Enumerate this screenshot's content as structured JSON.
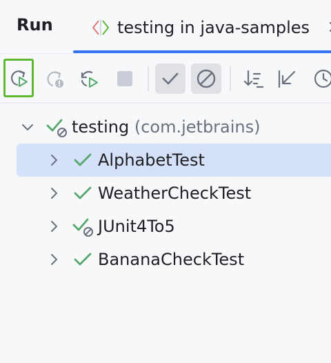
{
  "header": {
    "title": "Run",
    "tab_label": "testing in java-samples"
  },
  "toolbar": {
    "buttons": [
      {
        "name": "rerun-button",
        "icon": "rerun-icon"
      },
      {
        "name": "rerun-failed-button",
        "icon": "rerun-failed-icon"
      },
      {
        "name": "toggle-auto-test-button",
        "icon": "toggle-auto-test-icon"
      },
      {
        "name": "stop-button",
        "icon": "stop-icon"
      },
      {
        "name": "show-passed-button",
        "icon": "checkmark-icon",
        "toggled": true
      },
      {
        "name": "show-ignored-button",
        "icon": "ignored-icon",
        "toggled": true
      },
      {
        "name": "sort-button",
        "icon": "sort-icon"
      },
      {
        "name": "collapse-button",
        "icon": "collapse-icon"
      },
      {
        "name": "show-duration-button",
        "icon": "clock-icon"
      }
    ]
  },
  "tree": {
    "root": {
      "label": "testing",
      "package": "(com.jetbrains)",
      "status": "passed-with-ignored",
      "expanded": true
    },
    "children": [
      {
        "label": "AlphabetTest",
        "status": "passed",
        "selected": true
      },
      {
        "label": "WeatherCheckTest",
        "status": "passed"
      },
      {
        "label": "JUnit4To5",
        "status": "passed-with-ignored"
      },
      {
        "label": "BananaCheckTest",
        "status": "passed"
      }
    ]
  },
  "colors": {
    "accent": "#3574f0",
    "selection": "#d5e0f9",
    "passed": "#55a76a",
    "highlight_border": "#5fb832",
    "muted": "#6c707e"
  }
}
